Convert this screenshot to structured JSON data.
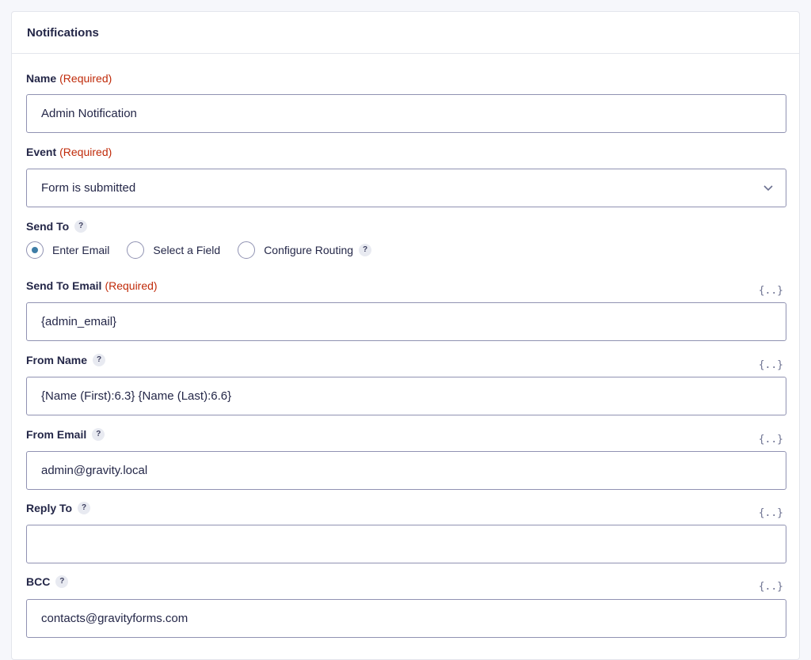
{
  "panel": {
    "title": "Notifications"
  },
  "required_text": "(Required)",
  "fields": {
    "name": {
      "label": "Name",
      "value": "Admin Notification"
    },
    "event": {
      "label": "Event",
      "selected": "Form is submitted"
    },
    "send_to": {
      "label": "Send To",
      "options": [
        {
          "label": "Enter Email",
          "checked": true
        },
        {
          "label": "Select a Field",
          "checked": false
        },
        {
          "label": "Configure Routing",
          "checked": false
        }
      ]
    },
    "send_to_email": {
      "label": "Send To Email",
      "value": "{admin_email}"
    },
    "from_name": {
      "label": "From Name",
      "value": "{Name (First):6.3} {Name (Last):6.6}"
    },
    "from_email": {
      "label": "From Email",
      "value": "admin@gravity.local"
    },
    "reply_to": {
      "label": "Reply To",
      "value": ""
    },
    "bcc": {
      "label": "BCC",
      "value": "contacts@gravityforms.com"
    }
  },
  "help_glyph": "?",
  "merge_tag_glyph": "{..}",
  "colors": {
    "required": "#c02b0a",
    "radio_dot": "#3e7da6",
    "border": "#9092b2"
  }
}
